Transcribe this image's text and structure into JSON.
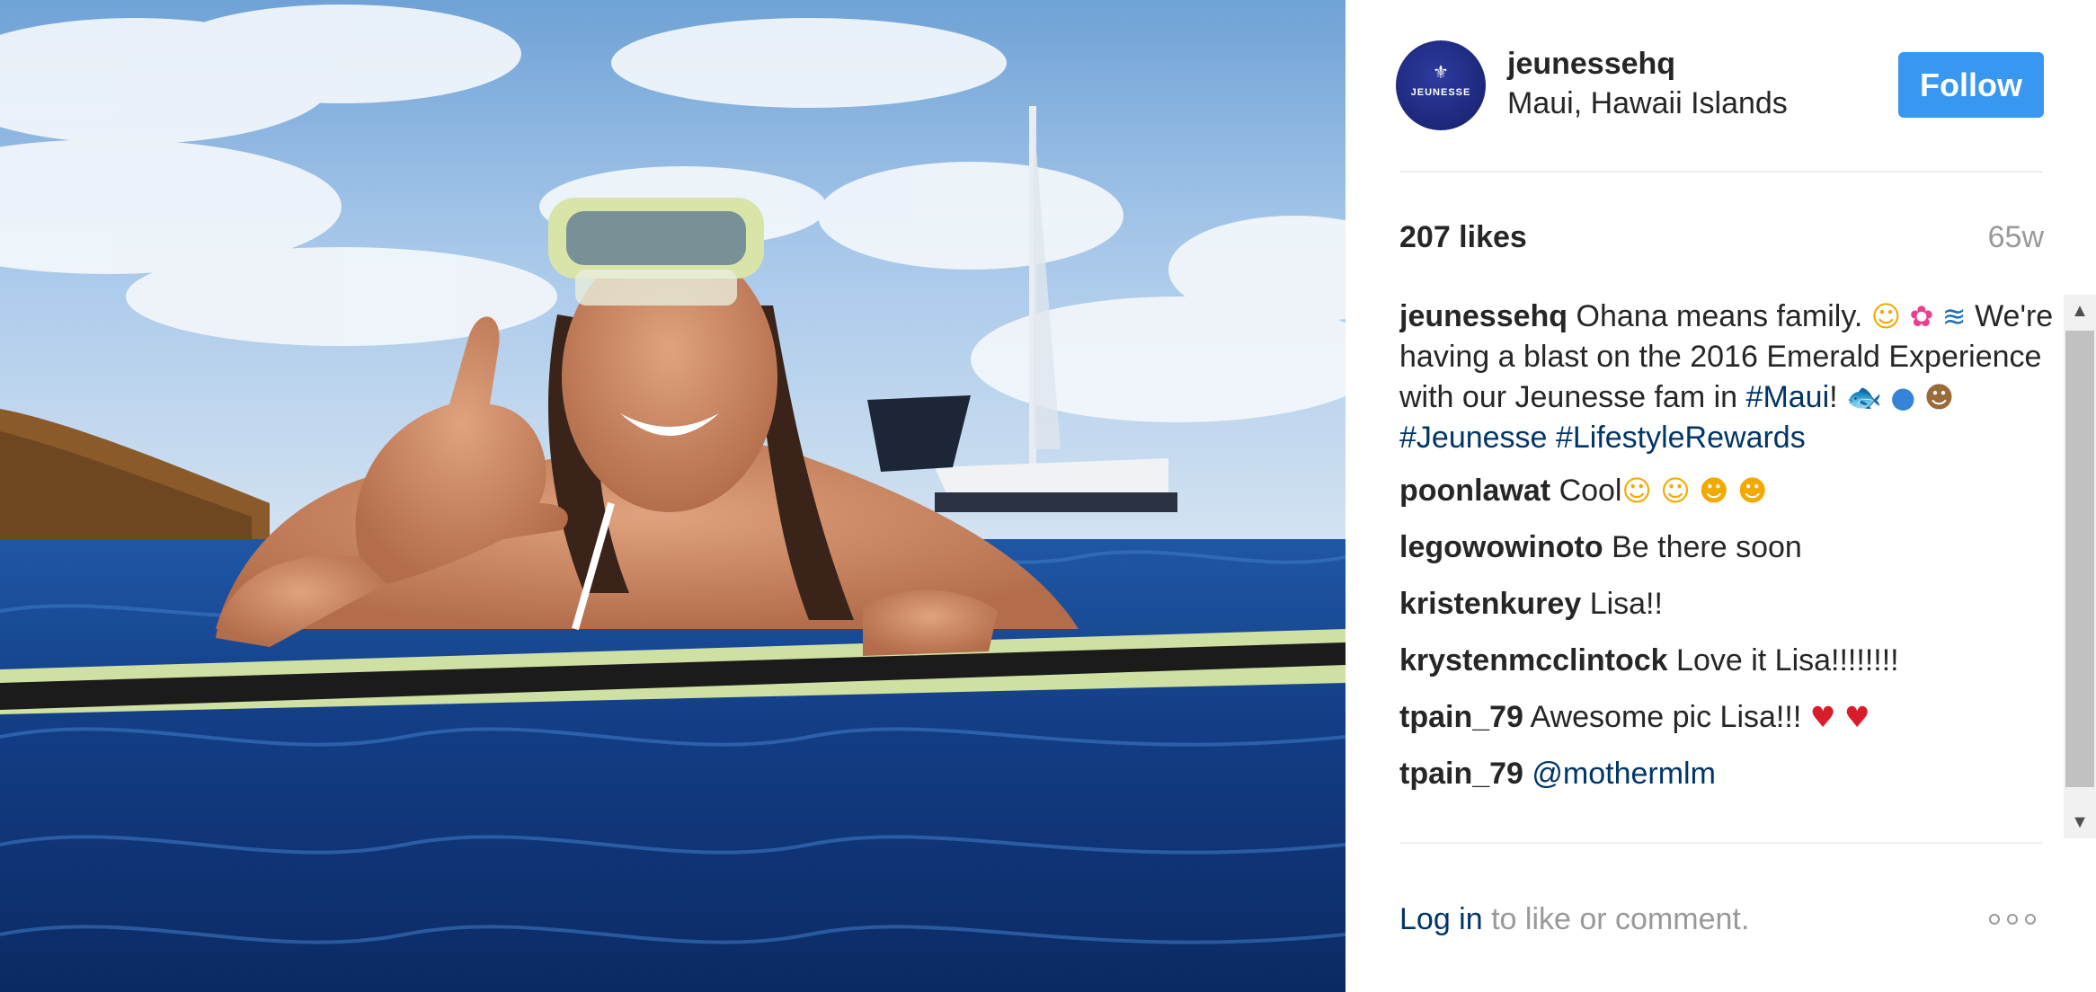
{
  "post": {
    "username": "jeunessehq",
    "location": "Maui, Hawaii Islands",
    "avatar_text": "JEUNESSE",
    "follow_label": "Follow",
    "likes": "207 likes",
    "age": "65w"
  },
  "caption": {
    "user": "jeunessehq",
    "part1": "Ohana means family.",
    "part2": "We're having a blast on the 2016 Emerald Experience with our Jeunesse fam in",
    "tag1": "#Maui",
    "after_tag1": "!",
    "tag2": "#Jeunesse",
    "tag3": "#LifestyleRewards"
  },
  "comments": [
    {
      "user": "poonlawat",
      "text": "Cool"
    },
    {
      "user": "legowowinoto",
      "text": "Be there soon"
    },
    {
      "user": "kristenkurey",
      "text": "Lisa!!"
    },
    {
      "user": "krystenmcclintock",
      "text": "Love it Lisa!!!!!!!!"
    },
    {
      "user": "tpain_79",
      "text": "Awesome pic Lisa!!!"
    },
    {
      "user": "tpain_79",
      "mention": "@mothermlm"
    }
  ],
  "footer": {
    "login_label": "Log in",
    "login_suffix": " to like or comment."
  },
  "icons": {
    "more": "more-options-icon",
    "scroll_up": "scroll-up-arrow-icon",
    "scroll_down": "scroll-down-arrow-icon"
  },
  "colors": {
    "follow_bg": "#3897f0",
    "link": "#003569",
    "muted": "#999999",
    "text": "#262626"
  }
}
